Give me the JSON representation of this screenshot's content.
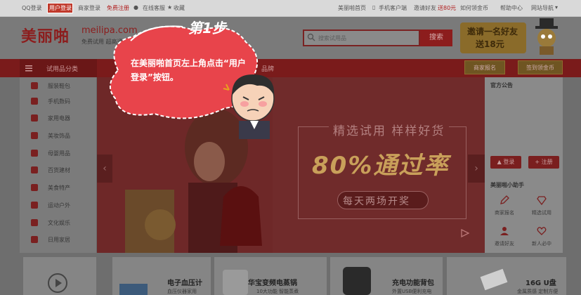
{
  "topbar": {
    "qq_login": "QQ登录",
    "user_login": "用户登录",
    "merchant_login": "商家登录",
    "free_register": "免费注册",
    "online_service": "在线客服",
    "favorite": "收藏",
    "home": "美丽啪首页",
    "mobile": "手机客户端",
    "invite": "邀请好友",
    "invite_reward": "送80元",
    "rule_center": "如何领金币",
    "help": "帮助中心",
    "nav": "网站导航"
  },
  "header": {
    "logo_cn": "美丽啪",
    "logo_en": "meilipa.com",
    "logo_sub": "免费试用 超高通",
    "search_placeholder": "搜索试用品",
    "search_button": "搜索",
    "promo_line1": "邀请一名好友",
    "promo_line2": "送18元"
  },
  "nav": {
    "category_label": "试用品分类",
    "extra_item": "品牌",
    "merchant_signup": "商家报名",
    "earn_coins": "签到领金币"
  },
  "categories": [
    {
      "label": "服装鞋包"
    },
    {
      "label": "手机数码"
    },
    {
      "label": "家用电器"
    },
    {
      "label": "美妆饰品"
    },
    {
      "label": "母婴用品"
    },
    {
      "label": "百货建材"
    },
    {
      "label": "美食特产"
    },
    {
      "label": "运动户外"
    },
    {
      "label": "文化娱乐"
    },
    {
      "label": "日用家居"
    }
  ],
  "banner": {
    "title": "精选试用 样样好货",
    "percent": "80%通过率",
    "pill": "每天两场开奖",
    "arrow_left": "‹",
    "arrow_right": "›"
  },
  "right_panel": {
    "title": "官方公告",
    "login": "登录",
    "register": "注册",
    "helper_title": "美丽啪小助手",
    "cells": [
      {
        "label": "商家报名"
      },
      {
        "label": "精选试用"
      },
      {
        "label": "邀请好友"
      },
      {
        "label": "新人必中"
      }
    ]
  },
  "bottom_cards": [
    {
      "title": "电子血压计",
      "sub": "血压仪器家用"
    },
    {
      "title": "华宝变频电蒸锅",
      "sub": "10大功能 智能蒸煮"
    },
    {
      "title": "充电功能背包",
      "sub": "外置USB便利充电"
    },
    {
      "title": "16G U盘",
      "sub": "金属质感 定制方便"
    }
  ],
  "tutorial": {
    "step": "第1步",
    "instruction": "在美丽啪首页左上角点击“用户登录”按钮。"
  },
  "colors": {
    "accent_red": "#c0392b",
    "overlay_red": "#e8444b",
    "highlight_border": "#ffffff"
  }
}
